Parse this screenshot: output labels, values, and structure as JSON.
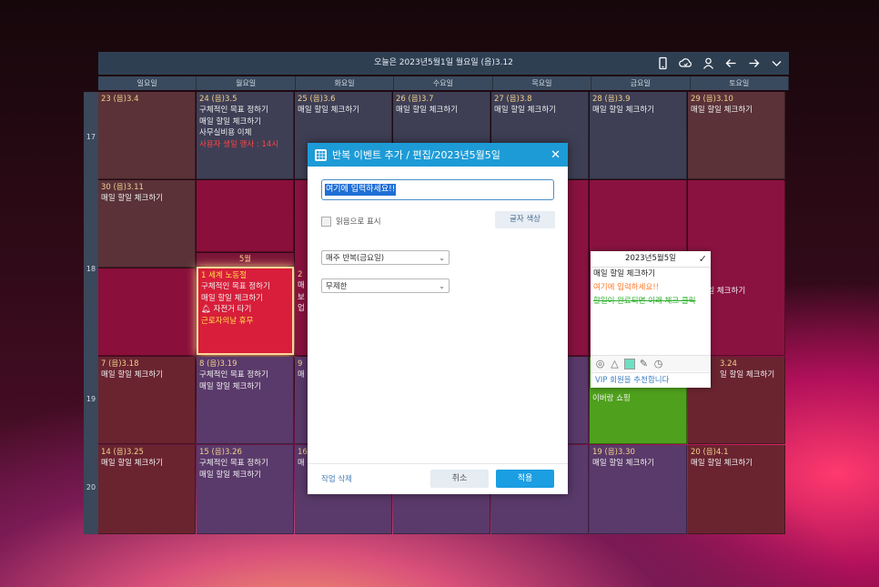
{
  "header": {
    "title": "오늘은 2023년5월1일 월요일 (음)3.12",
    "icons": [
      "phone-icon",
      "cloud-sync-icon",
      "user-icon",
      "arrow-left-icon",
      "arrow-right-icon",
      "chevron-down-icon"
    ]
  },
  "weekdays": [
    "일요일",
    "월요일",
    "화요일",
    "수요일",
    "목요일",
    "금요일",
    "토요일"
  ],
  "week_numbers": [
    "17",
    "18",
    "19",
    "20"
  ],
  "row1": [
    {
      "date": "23 (음)3.4",
      "events": []
    },
    {
      "date": "24 (음)3.5",
      "events": [
        "구체적인 목표 정하기",
        "매일 할일 체크하기",
        "사무실비용 이체",
        "사용자 생일 행사 : 14시"
      ]
    },
    {
      "date": "25 (음)3.6",
      "events": [
        "매일 할일 체크하기"
      ]
    },
    {
      "date": "26 (음)3.7",
      "events": [
        "매일 할일 체크하기"
      ]
    },
    {
      "date": "27 (음)3.8",
      "events": [
        "매일 할일 체크하기"
      ]
    },
    {
      "date": "28 (음)3.9",
      "events": [
        "매일 할일 체크하기"
      ]
    },
    {
      "date": "29 (음)3.10",
      "events": [
        "매일 할일 체크하기"
      ]
    }
  ],
  "row2": [
    {
      "date": "30 (음)3.11",
      "events": [
        "매일 할일 체크하기"
      ]
    },
    {
      "month": "5월",
      "date": "1 세계 노동절",
      "events": [
        "구체적인 목표 정하기",
        "매일 할일 체크하기",
        "자전거 타기",
        "근로자의날 휴무"
      ]
    },
    {
      "date": "2",
      "events": [
        "매",
        "보",
        "업"
      ]
    },
    {
      "date": "",
      "events": []
    },
    {
      "date": "",
      "events": []
    },
    {
      "date": "",
      "events": []
    },
    {
      "date": "",
      "events": [
        "일 할일 체크하기"
      ]
    }
  ],
  "row3": [
    {
      "date": "7 (음)3.18",
      "events": [
        "매일 할일 체크하기"
      ]
    },
    {
      "date": "8 (음)3.19",
      "events": [
        "구체적인 목표 정하기",
        "매일 할일 체크하기"
      ]
    },
    {
      "date": "9",
      "events": [
        "매"
      ]
    },
    {
      "date": "",
      "events": []
    },
    {
      "date": "",
      "events": []
    },
    {
      "date": "",
      "events": [
        "이버랑 쇼핑"
      ]
    },
    {
      "date": "3.24",
      "events": [
        "일 할일 체크하기"
      ]
    }
  ],
  "row4": [
    {
      "date": "14 (음)3.25",
      "events": [
        "매일 할일 체크하기"
      ]
    },
    {
      "date": "15 (음)3.26",
      "events": [
        "구체적인 목표 정하기",
        "매일 할일 체크하기"
      ]
    },
    {
      "date": "16",
      "events": [
        "매"
      ]
    },
    {
      "date": "",
      "events": []
    },
    {
      "date": "",
      "events": []
    },
    {
      "date": "19 (음)3.30",
      "events": [
        "매일 할일 체크하기"
      ]
    },
    {
      "date": "20 (음)4.1",
      "events": [
        "매일 할일 체크하기"
      ]
    }
  ],
  "dialog": {
    "title": "반복 이벤트 추가 / 편집/2023년5월5일",
    "input_value": "여기에 입력하세요!!",
    "readonly_label": "읽음으로 표시",
    "color_button": "글자 색상",
    "repeat_select": "매주 반복(금요일)",
    "limit_select": "무제한",
    "delete_label": "작업 삭제",
    "cancel_label": "취소",
    "apply_label": "적용"
  },
  "memo": {
    "date": "2023년5월5일",
    "lines": [
      "매일 할일 체크하기",
      "여기에 입력하세요!!",
      "할일이 완료되면 이래 체크 클릭"
    ],
    "vip": "VIP 회원을 추천합니다",
    "tools": [
      "check-circle-icon",
      "triangle-icon",
      "color-square-icon",
      "note-edit-icon",
      "clock-icon"
    ]
  },
  "colors": {
    "accent": "#1d9bd7",
    "selected_cell": "#d81e3a",
    "green_cell": "#4fa01c"
  }
}
